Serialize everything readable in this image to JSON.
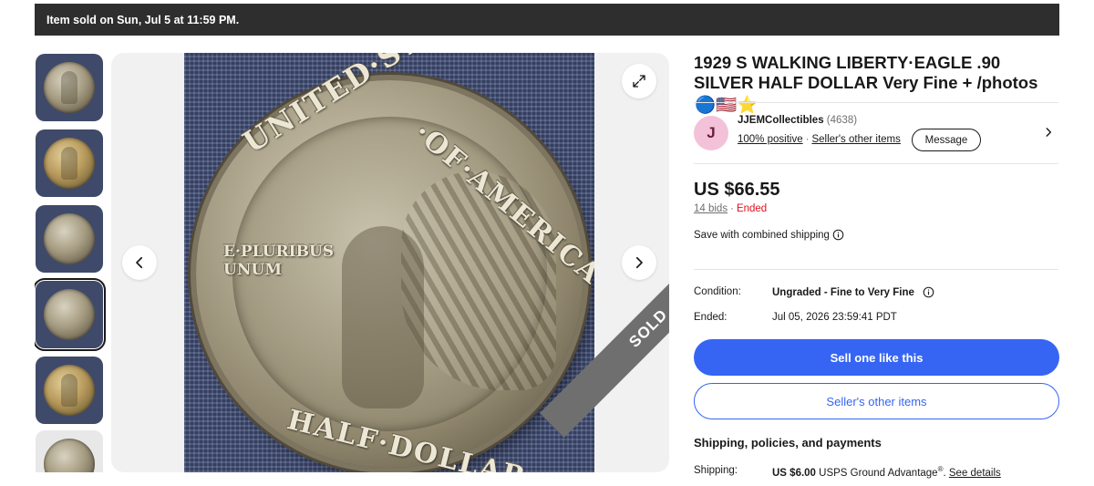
{
  "banner": {
    "text": "Item sold on Sun, Jul 5 at 11:59 PM."
  },
  "gallery": {
    "thumbnails": [
      {
        "alt": "coin-front"
      },
      {
        "alt": "coin-front-gold"
      },
      {
        "alt": "coin-back"
      },
      {
        "alt": "coin-back-selected"
      },
      {
        "alt": "coin-front-gold-2"
      },
      {
        "alt": "coin-front-partial"
      }
    ],
    "selected_index": 3,
    "coin_text": {
      "top_left": "UNITED·STATES",
      "top_right": "·OF·AMERICA·",
      "motto_line1": "E·PLURIBUS",
      "motto_line2": "UNUM",
      "bottom": "HALF·DOLLAR"
    },
    "sold_ribbon": "SOLD",
    "icons": {
      "prev": "chevron-left-icon",
      "next": "chevron-right-icon",
      "expand": "expand-icon"
    }
  },
  "listing": {
    "title": "1929 S WALKING LIBERTY·EAGLE .90 SILVER HALF DOLLAR Very Fine + /photos",
    "title_emojis": "🔵🇺🇸⭐"
  },
  "seller": {
    "avatar_letter": "J",
    "avatar_color": "#f3c2d8",
    "name": "JJEMCollectibles",
    "feedback_count": "(4638)",
    "positive": "100% positive",
    "other_items_link": "Seller's other items",
    "message_button": "Message"
  },
  "price": {
    "amount": "US $66.55",
    "bids": "14 bids",
    "status": "Ended",
    "combined_shipping": "Save with combined shipping"
  },
  "details": {
    "condition_label": "Condition:",
    "condition_value": "Ungraded - Fine to Very Fine",
    "ended_label": "Ended:",
    "ended_value": "Jul 05, 2026 23:59:41 PDT"
  },
  "actions": {
    "sell_one": "Sell one like this",
    "sellers_other_items": "Seller's other items"
  },
  "shipping": {
    "heading": "Shipping, policies, and payments",
    "label": "Shipping:",
    "price": "US $6.00",
    "service": "USPS Ground Advantage",
    "registered_mark": "®",
    "details_link": "See details"
  },
  "colors": {
    "banner_bg": "#2e2e2e",
    "primary_blue": "#3665f3",
    "ended_red": "#e0101f"
  }
}
